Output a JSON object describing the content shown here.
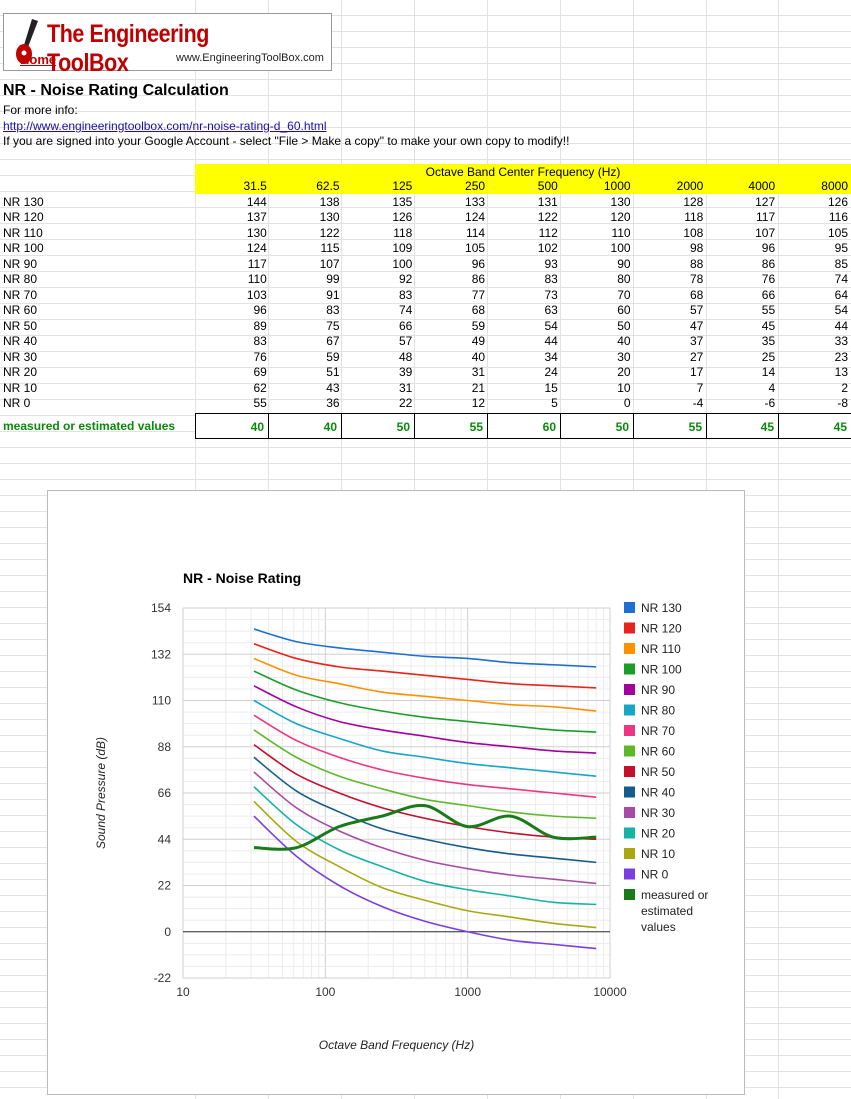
{
  "logo": {
    "title": "The Engineering ToolBox",
    "home": "Home",
    "url": "www.EngineeringToolBox.com"
  },
  "page": {
    "heading": "NR - Noise Rating Calculation",
    "more_info": "For more info:",
    "link": "http://www.engineeringtoolbox.com/nr-noise-rating-d_60.html",
    "note": "If you are signed into your Google Account - select \"File > Make a copy\" to make your own copy to modify!!"
  },
  "table": {
    "group_header": "Octave Band Center Frequency (Hz)",
    "frequencies": [
      "31.5",
      "62.5",
      "125",
      "250",
      "500",
      "1000",
      "2000",
      "4000",
      "8000"
    ],
    "rows": [
      {
        "label": "NR 130",
        "values": [
          144,
          138,
          135,
          133,
          131,
          130,
          128,
          127,
          126
        ]
      },
      {
        "label": "NR 120",
        "values": [
          137,
          130,
          126,
          124,
          122,
          120,
          118,
          117,
          116
        ]
      },
      {
        "label": "NR 110",
        "values": [
          130,
          122,
          118,
          114,
          112,
          110,
          108,
          107,
          105
        ]
      },
      {
        "label": "NR 100",
        "values": [
          124,
          115,
          109,
          105,
          102,
          100,
          98,
          96,
          95
        ]
      },
      {
        "label": "NR 90",
        "values": [
          117,
          107,
          100,
          96,
          93,
          90,
          88,
          86,
          85
        ]
      },
      {
        "label": "NR 80",
        "values": [
          110,
          99,
          92,
          86,
          83,
          80,
          78,
          76,
          74
        ]
      },
      {
        "label": "NR 70",
        "values": [
          103,
          91,
          83,
          77,
          73,
          70,
          68,
          66,
          64
        ]
      },
      {
        "label": "NR 60",
        "values": [
          96,
          83,
          74,
          68,
          63,
          60,
          57,
          55,
          54
        ]
      },
      {
        "label": "NR 50",
        "values": [
          89,
          75,
          66,
          59,
          54,
          50,
          47,
          45,
          44
        ]
      },
      {
        "label": "NR 40",
        "values": [
          83,
          67,
          57,
          49,
          44,
          40,
          37,
          35,
          33
        ]
      },
      {
        "label": "NR 30",
        "values": [
          76,
          59,
          48,
          40,
          34,
          30,
          27,
          25,
          23
        ]
      },
      {
        "label": "NR 20",
        "values": [
          69,
          51,
          39,
          31,
          24,
          20,
          17,
          14,
          13
        ]
      },
      {
        "label": "NR 10",
        "values": [
          62,
          43,
          31,
          21,
          15,
          10,
          7,
          4,
          2
        ]
      },
      {
        "label": "NR 0",
        "values": [
          55,
          36,
          22,
          12,
          5,
          0,
          -4,
          -6,
          -8
        ]
      }
    ],
    "measured_label": "measured or estimated values",
    "measured_values": [
      40,
      40,
      50,
      55,
      60,
      50,
      55,
      45,
      45
    ]
  },
  "chart_data": {
    "type": "line",
    "title": "NR - Noise Rating",
    "xlabel": "Octave Band Frequency (Hz)",
    "ylabel": "Sound Pressure (dB)",
    "x_scale": "log",
    "xlim": [
      10,
      10000
    ],
    "ylim": [
      -22,
      154
    ],
    "x_ticks": [
      "10",
      "100",
      "1000",
      "10000"
    ],
    "y_ticks": [
      "154",
      "132",
      "110",
      "88",
      "66",
      "44",
      "22",
      "0",
      "-22"
    ],
    "grid": true,
    "legend_position": "right",
    "x": [
      31.5,
      62.5,
      125,
      250,
      500,
      1000,
      2000,
      4000,
      8000
    ],
    "series": [
      {
        "name": "NR 130",
        "color": "#1f6fd1",
        "values": [
          144,
          138,
          135,
          133,
          131,
          130,
          128,
          127,
          126
        ]
      },
      {
        "name": "NR 120",
        "color": "#e8231b",
        "values": [
          137,
          130,
          126,
          124,
          122,
          120,
          118,
          117,
          116
        ]
      },
      {
        "name": "NR 110",
        "color": "#ff9000",
        "values": [
          130,
          122,
          118,
          114,
          112,
          110,
          108,
          107,
          105
        ]
      },
      {
        "name": "NR 100",
        "color": "#1a9e2a",
        "values": [
          124,
          115,
          109,
          105,
          102,
          100,
          98,
          96,
          95
        ]
      },
      {
        "name": "NR 90",
        "color": "#a4009e",
        "values": [
          117,
          107,
          100,
          96,
          93,
          90,
          88,
          86,
          85
        ]
      },
      {
        "name": "NR 80",
        "color": "#16a6c8",
        "values": [
          110,
          99,
          92,
          86,
          83,
          80,
          78,
          76,
          74
        ]
      },
      {
        "name": "NR 70",
        "color": "#ee3584",
        "values": [
          103,
          91,
          83,
          77,
          73,
          70,
          68,
          66,
          64
        ]
      },
      {
        "name": "NR 60",
        "color": "#5fb82a",
        "values": [
          96,
          83,
          74,
          68,
          63,
          60,
          57,
          55,
          54
        ]
      },
      {
        "name": "NR 50",
        "color": "#c4102d",
        "values": [
          89,
          75,
          66,
          59,
          54,
          50,
          47,
          45,
          44
        ]
      },
      {
        "name": "NR 40",
        "color": "#175a8c",
        "values": [
          83,
          67,
          57,
          49,
          44,
          40,
          37,
          35,
          33
        ]
      },
      {
        "name": "NR 30",
        "color": "#a64ca6",
        "values": [
          76,
          59,
          48,
          40,
          34,
          30,
          27,
          25,
          23
        ]
      },
      {
        "name": "NR 20",
        "color": "#14b3a3",
        "values": [
          69,
          51,
          39,
          31,
          24,
          20,
          17,
          14,
          13
        ]
      },
      {
        "name": "NR 10",
        "color": "#a8a811",
        "values": [
          62,
          43,
          31,
          21,
          15,
          10,
          7,
          4,
          2
        ]
      },
      {
        "name": "NR 0",
        "color": "#7b3fe0",
        "values": [
          55,
          36,
          22,
          12,
          5,
          0,
          -4,
          -6,
          -8
        ]
      },
      {
        "name": "measured or estimated values",
        "color": "#1a7a1a",
        "values": [
          40,
          40,
          50,
          55,
          60,
          50,
          55,
          45,
          45
        ]
      }
    ]
  }
}
